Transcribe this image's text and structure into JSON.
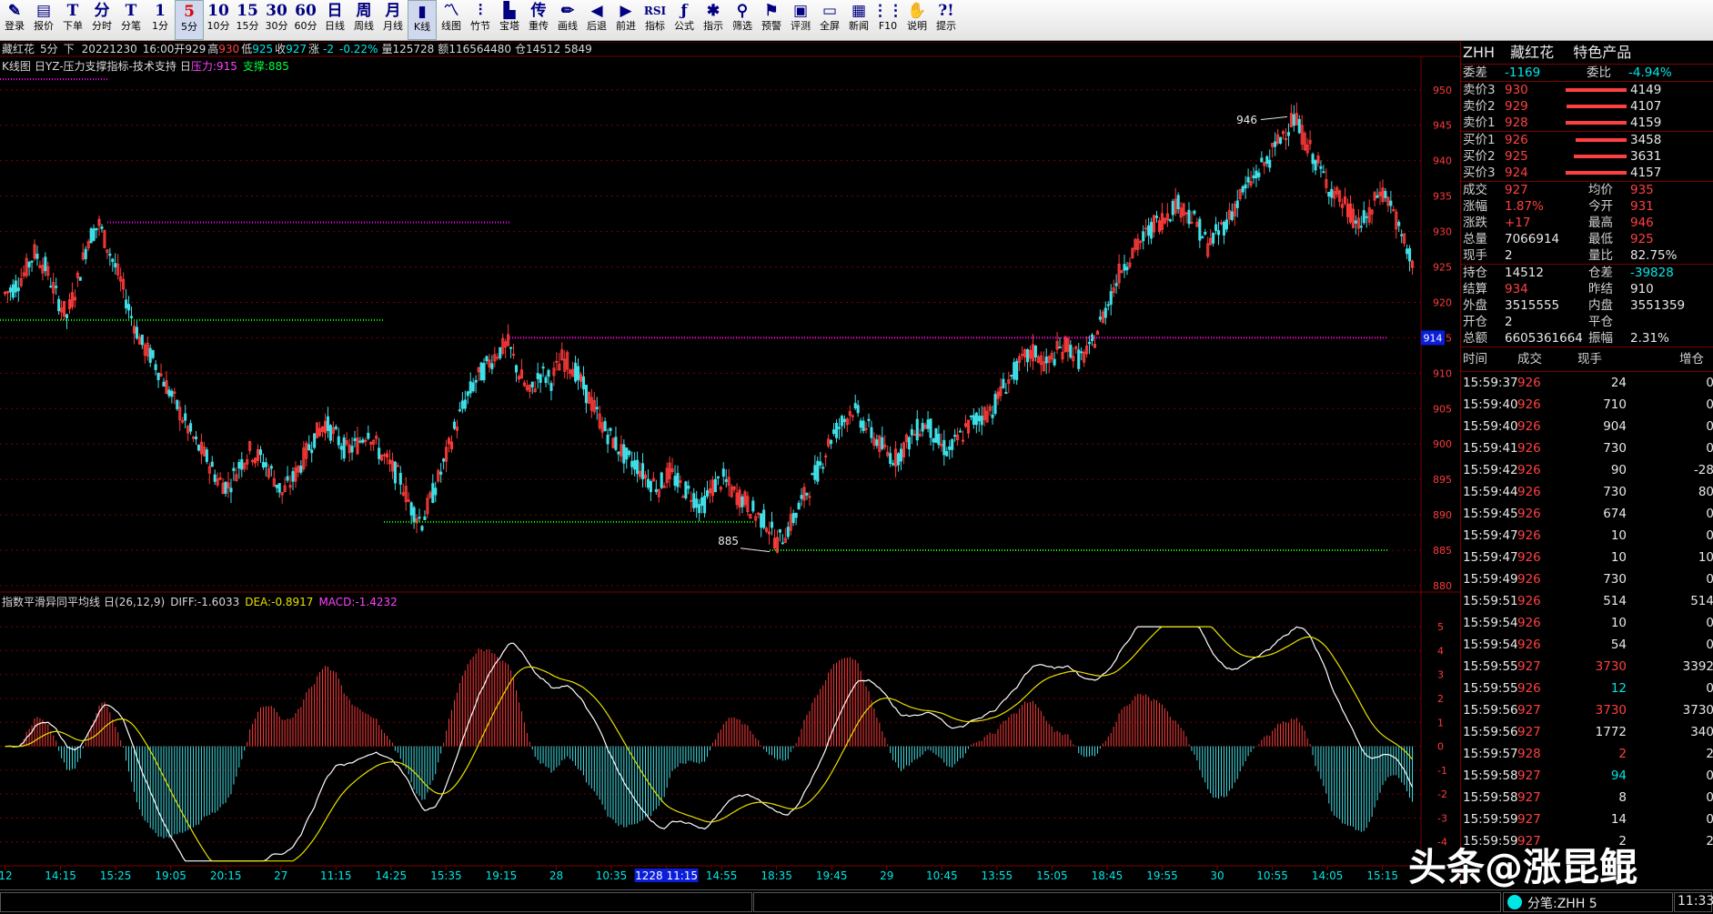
{
  "toolbar": [
    {
      "icon": "pen-icon",
      "glyph": "✎",
      "label": "登录"
    },
    {
      "icon": "quote-icon",
      "glyph": "▤",
      "label": "报价"
    },
    {
      "icon": "order-icon",
      "glyph": "T",
      "label": "下单"
    },
    {
      "icon": "timeshare-icon",
      "glyph": "分",
      "label": "分时"
    },
    {
      "icon": "tick-icon",
      "glyph": "T",
      "label": "分笔"
    },
    {
      "icon": "1min-icon",
      "glyph": "1",
      "label": "1分"
    },
    {
      "icon": "5min-icon",
      "glyph": "5",
      "label": "5分",
      "color": "red",
      "active": true
    },
    {
      "icon": "10min-icon",
      "glyph": "10",
      "label": "10分"
    },
    {
      "icon": "15min-icon",
      "glyph": "15",
      "label": "15分"
    },
    {
      "icon": "30min-icon",
      "glyph": "30",
      "label": "30分"
    },
    {
      "icon": "60min-icon",
      "glyph": "60",
      "label": "60分"
    },
    {
      "icon": "day-icon",
      "glyph": "日",
      "label": "日线"
    },
    {
      "icon": "week-icon",
      "glyph": "周",
      "label": "周线"
    },
    {
      "icon": "month-icon",
      "glyph": "月",
      "label": "月线"
    },
    {
      "icon": "kline-icon",
      "glyph": "▮",
      "label": "K线",
      "active": true
    },
    {
      "icon": "linechart-icon",
      "glyph": "〽",
      "label": "线图"
    },
    {
      "icon": "bamboo-icon",
      "glyph": "⫶",
      "label": "竹节"
    },
    {
      "icon": "tower-icon",
      "glyph": "▙",
      "label": "宝塔"
    },
    {
      "icon": "ref-icon",
      "glyph": "传",
      "label": "重传"
    },
    {
      "icon": "draw-icon",
      "glyph": "✏",
      "label": "画线"
    },
    {
      "icon": "back-icon",
      "glyph": "◀",
      "label": "后退"
    },
    {
      "icon": "forward-icon",
      "glyph": "▶",
      "label": "前进"
    },
    {
      "icon": "indicator-icon",
      "glyph": "RSI",
      "label": "指标"
    },
    {
      "icon": "formula-icon",
      "glyph": "ƒ",
      "label": "公式"
    },
    {
      "icon": "guide-icon",
      "glyph": "✱",
      "label": "指示"
    },
    {
      "icon": "filter-icon",
      "glyph": "⚲",
      "label": "筛选"
    },
    {
      "icon": "alert-icon",
      "glyph": "⚑",
      "label": "预警"
    },
    {
      "icon": "evaluate-icon",
      "glyph": "▣",
      "label": "评测"
    },
    {
      "icon": "fullscreen-icon",
      "glyph": "▭",
      "label": "全屏"
    },
    {
      "icon": "news-icon",
      "glyph": "▦",
      "label": "新闻"
    },
    {
      "icon": "f10-icon",
      "glyph": "⋮⋮",
      "label": "F10"
    },
    {
      "icon": "help-icon",
      "glyph": "✋",
      "label": "说明"
    },
    {
      "icon": "tip-icon",
      "glyph": "?!",
      "label": "提示"
    }
  ],
  "header": {
    "line1": {
      "name": "藏红花",
      "period": "5分",
      "dir": "下",
      "date": "20221230",
      "time": "16:00",
      "open_label": "开",
      "open": "929",
      "high_label": "高",
      "high": "930",
      "low_label": "低",
      "low": "925",
      "close_label": "收",
      "close": "927",
      "chg_label": "涨",
      "chg": "-2",
      "chg_pct": "-0.22%",
      "vol_label": "量",
      "vol": "125728",
      "amt_label": "额",
      "amt": "116564480",
      "oi_label": "仓",
      "oi": "14512",
      "oi2": "5849"
    },
    "line2": {
      "k": "K线图",
      "flag1": "日",
      "indicator": "YZ-压力支撑指标-技术支持",
      "flag2": "日",
      "press_label": "压力:",
      "press": "915",
      "support_label": "支撑:",
      "support": "885"
    },
    "macd": {
      "name": "指数平滑异同平均线",
      "flag": "日",
      "params": "(26,12,9)",
      "diff_label": "DIFF:",
      "diff": "-1.6033",
      "dea_label": "DEA:",
      "dea": "-0.8917",
      "macd_label": "MACD:",
      "macd": "-1.4232"
    }
  },
  "chart_data": {
    "type": "candlestick",
    "symbol": "藏红花",
    "period": "5分",
    "price_axis": [
      950,
      945,
      940,
      935,
      930,
      925,
      920,
      915,
      910,
      905,
      900,
      895,
      890,
      885,
      880
    ],
    "price_range": [
      880,
      951
    ],
    "macd_axis": [
      5,
      4,
      3,
      2,
      1,
      0,
      -1,
      -2,
      -3,
      -4
    ],
    "macd_range": [
      -5,
      5.5
    ],
    "time_labels": [
      "12",
      "14:15",
      "15:25",
      "19:05",
      "20:15",
      "27",
      "11:15",
      "14:25",
      "15:35",
      "19:15",
      "28",
      "10:35",
      "1228 11:15",
      "14:55",
      "18:35",
      "19:45",
      "29",
      "10:45",
      "13:55",
      "15:05",
      "18:45",
      "19:55",
      "30",
      "10:55",
      "14:05",
      "15:15"
    ],
    "time_highlight": "1228 11:15",
    "annotations": [
      {
        "text": "946",
        "type": "high"
      },
      {
        "text": "885",
        "type": "low"
      }
    ],
    "last_price_tag": "914",
    "pressure_level": 915,
    "support_level": 885,
    "closes": [
      922,
      924,
      927,
      925,
      921,
      918,
      923,
      929,
      931,
      927,
      923,
      918,
      914,
      912,
      909,
      906,
      903,
      900,
      898,
      895,
      894,
      897,
      899,
      898,
      896,
      893,
      895,
      898,
      901,
      903,
      901,
      899,
      900,
      902,
      899,
      897,
      895,
      891,
      889,
      893,
      897,
      902,
      906,
      909,
      911,
      913,
      914,
      910,
      907,
      910,
      909,
      912,
      911,
      908,
      905,
      902,
      900,
      898,
      897,
      895,
      894,
      896,
      894,
      893,
      891,
      894,
      895,
      893,
      892,
      890,
      889,
      886,
      888,
      891,
      894,
      897,
      901,
      903,
      905,
      903,
      901,
      899,
      898,
      900,
      902,
      903,
      900,
      899,
      901,
      903,
      904,
      905,
      908,
      910,
      912,
      913,
      911,
      913,
      914,
      912,
      913,
      917,
      921,
      925,
      927,
      929,
      931,
      932,
      934,
      933,
      931,
      928,
      930,
      932,
      935,
      937,
      939,
      941,
      944,
      946,
      943,
      940,
      937,
      935,
      933,
      931,
      932,
      936,
      934,
      929,
      926
    ],
    "candles_note": "",
    "colors": {
      "up": "#ff3b3b",
      "down": "#40e0e8",
      "diff": "#ffffff",
      "dea": "#e8e000",
      "grid": "#7a0000",
      "pressure": "#ff00ff",
      "support": "#00ff00",
      "axis_text": "#ff3b3b"
    }
  },
  "quote": {
    "code": "ZHH",
    "name": "藏红花",
    "category": "特色产品",
    "weicha_label": "委差",
    "weicha": "-1169",
    "weibi_label": "委比",
    "weibi": "-4.94%",
    "asks": [
      {
        "label": "卖价3",
        "price": "930",
        "vol": "4149",
        "bar": 0.98
      },
      {
        "label": "卖价2",
        "price": "929",
        "vol": "4107",
        "bar": 0.97
      },
      {
        "label": "卖价1",
        "price": "928",
        "vol": "4159",
        "bar": 0.99
      }
    ],
    "bids": [
      {
        "label": "买价1",
        "price": "926",
        "vol": "3458",
        "bar": 0.82
      },
      {
        "label": "买价2",
        "price": "925",
        "vol": "3631",
        "bar": 0.86
      },
      {
        "label": "买价3",
        "price": "924",
        "vol": "4157",
        "bar": 0.99
      }
    ],
    "stats": [
      [
        {
          "l": "成交",
          "v": "927",
          "c": "red"
        },
        {
          "l": "均价",
          "v": "935",
          "c": "red"
        }
      ],
      [
        {
          "l": "涨幅",
          "v": "1.87%",
          "c": "red"
        },
        {
          "l": "今开",
          "v": "931",
          "c": "red"
        }
      ],
      [
        {
          "l": "涨跌",
          "v": "+17",
          "c": "red"
        },
        {
          "l": "最高",
          "v": "946",
          "c": "red"
        }
      ],
      [
        {
          "l": "总量",
          "v": "7066914",
          "c": "white"
        },
        {
          "l": "最低",
          "v": "925",
          "c": "red"
        }
      ],
      [
        {
          "l": "现手",
          "v": "2",
          "c": "white"
        },
        {
          "l": "量比",
          "v": "82.75%",
          "c": "white"
        }
      ]
    ],
    "stats2": [
      [
        {
          "l": "持仓",
          "v": "14512",
          "c": "white"
        },
        {
          "l": "仓差",
          "v": "-39828",
          "c": "cyan"
        }
      ],
      [
        {
          "l": "结算",
          "v": "934",
          "c": "red"
        },
        {
          "l": "昨结",
          "v": "910",
          "c": "white"
        }
      ],
      [
        {
          "l": "外盘",
          "v": "3515555",
          "c": "white"
        },
        {
          "l": "内盘",
          "v": "3551359",
          "c": "white"
        }
      ],
      [
        {
          "l": "开仓",
          "v": "2",
          "c": "white"
        },
        {
          "l": "平仓",
          "v": "",
          "c": "white"
        }
      ],
      [
        {
          "l": "总额",
          "v": "6605361664",
          "c": "white"
        },
        {
          "l": "振幅",
          "v": "2.31%",
          "c": "white"
        }
      ]
    ]
  },
  "ticks": {
    "headers": [
      "时间",
      "成交",
      "现手",
      "增仓"
    ],
    "rows": [
      {
        "t": "15:59:37",
        "p": "926",
        "v": "24",
        "vc": "white",
        "d": "0"
      },
      {
        "t": "15:59:40",
        "p": "926",
        "v": "710",
        "vc": "white",
        "d": "0"
      },
      {
        "t": "15:59:40",
        "p": "926",
        "v": "904",
        "vc": "white",
        "d": "0"
      },
      {
        "t": "15:59:41",
        "p": "926",
        "v": "730",
        "vc": "white",
        "d": "0"
      },
      {
        "t": "15:59:42",
        "p": "926",
        "v": "90",
        "vc": "white",
        "d": "-28"
      },
      {
        "t": "15:59:44",
        "p": "926",
        "v": "730",
        "vc": "white",
        "d": "80"
      },
      {
        "t": "15:59:45",
        "p": "926",
        "v": "674",
        "vc": "white",
        "d": "0"
      },
      {
        "t": "15:59:47",
        "p": "926",
        "v": "10",
        "vc": "white",
        "d": "0"
      },
      {
        "t": "15:59:47",
        "p": "926",
        "v": "10",
        "vc": "white",
        "d": "10"
      },
      {
        "t": "15:59:49",
        "p": "926",
        "v": "730",
        "vc": "white",
        "d": "0"
      },
      {
        "t": "15:59:51",
        "p": "926",
        "v": "514",
        "vc": "white",
        "d": "514"
      },
      {
        "t": "15:59:54",
        "p": "926",
        "v": "10",
        "vc": "white",
        "d": "0"
      },
      {
        "t": "15:59:54",
        "p": "926",
        "v": "54",
        "vc": "white",
        "d": "0"
      },
      {
        "t": "15:59:55",
        "p": "927",
        "v": "3730",
        "vc": "red",
        "d": "3392"
      },
      {
        "t": "15:59:55",
        "p": "926",
        "v": "12",
        "vc": "cyan",
        "d": "0"
      },
      {
        "t": "15:59:56",
        "p": "927",
        "v": "3730",
        "vc": "red",
        "d": "3730"
      },
      {
        "t": "15:59:56",
        "p": "927",
        "v": "1772",
        "vc": "white",
        "d": "340"
      },
      {
        "t": "15:59:57",
        "p": "928",
        "v": "2",
        "vc": "red",
        "d": "2"
      },
      {
        "t": "15:59:58",
        "p": "927",
        "v": "94",
        "vc": "cyan",
        "d": "0"
      },
      {
        "t": "15:59:58",
        "p": "927",
        "v": "8",
        "vc": "white",
        "d": "0"
      },
      {
        "t": "15:59:59",
        "p": "927",
        "v": "14",
        "vc": "white",
        "d": "0"
      },
      {
        "t": "15:59:59",
        "p": "927",
        "v": "2",
        "vc": "white",
        "d": "2"
      }
    ]
  },
  "status": {
    "feed": "分笔:ZHH 5",
    "clock": "11:33"
  },
  "watermark": "头条@涨昆鲲"
}
